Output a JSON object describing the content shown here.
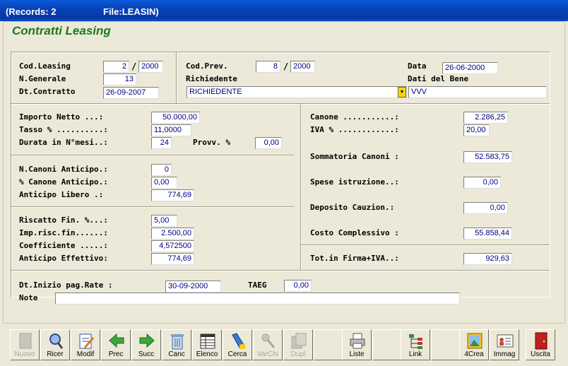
{
  "window": {
    "records": "(Records: 2",
    "file": "File:LEASIN)"
  },
  "form": {
    "title": "Contratti Leasing"
  },
  "header": {
    "cod_leasing_label": "Cod.Leasing",
    "cod_leasing_num": "2",
    "cod_leasing_year": "2000",
    "n_generale_label": "N.Generale",
    "n_generale": "13",
    "dt_contratto_label": "Dt.Contratto",
    "dt_contratto": "26-09-2007",
    "cod_prev_label": "Cod.Prev.",
    "cod_prev_num": "8",
    "cod_prev_year": "2000",
    "richiedente_label": "Richiedente",
    "richiedente": "RICHIEDENTE",
    "data_label": "Data",
    "data": "26-06-2000",
    "dati_bene_label": "Dati del Bene",
    "dati_bene": "VVV",
    "slash": "/"
  },
  "left": {
    "importo_netto_label": "Importo Netto ...:",
    "importo_netto": "50.000,00",
    "tasso_label": "Tasso % ..........:",
    "tasso": "11,0000",
    "durata_label": "Durata in N°mesi..:",
    "durata": "24",
    "provv_label": "Provv. %",
    "provv": "0,00",
    "n_canoni_anticipo_label": "N.Canoni Anticipo.:",
    "n_canoni_anticipo": "0",
    "canone_anticipo_label": "% Canone Anticipo.:",
    "canone_anticipo": "0,00",
    "anticipo_libero_label": "Anticipo Libero .:",
    "anticipo_libero": "774,69",
    "riscatto_label": "Riscatto Fin. %...:",
    "riscatto": "5,00",
    "imp_risc_label": "Imp.risc.fin......:",
    "imp_risc": "2.500,00",
    "coefficiente_label": "Coefficiente .....:",
    "coefficiente": "4,572500",
    "anticipo_effettivo_label": "Anticipo Effettivo:",
    "anticipo_effettivo": "774,69"
  },
  "right": {
    "canone_label": "Canone ...........:",
    "canone": "2.286,25",
    "iva_label": "IVA % ............:",
    "iva": "20,00",
    "sommatoria_label": "Sommatoria Canoni :",
    "sommatoria": "52.583,75",
    "spese_label": "Spese istruzione..:",
    "spese": "0,00",
    "deposito_label": "Deposito Cauzion.:",
    "deposito": "0,00",
    "costo_label": "Costo Complessivo :",
    "costo": "55.858,44",
    "tot_firma_label": "Tot.in Firma+IVA..:",
    "tot_firma": "929,63"
  },
  "footer": {
    "dt_inizio_label": "Dt.Inizio pag.Rate :",
    "dt_inizio": "30-09-2000",
    "taeg_label": "TAEG",
    "taeg": "0,00",
    "note_label": "Note",
    "note": ""
  },
  "toolbar": {
    "nuovo": "Nuovo",
    "ricer": "Ricer",
    "modif": "Modif",
    "prec": "Prec",
    "succ": "Succ",
    "canc": "Canc",
    "elenco": "Elenco",
    "cerca": "Cerca",
    "varchi": "VarChi",
    "dupl": "Dupl",
    "liste": "Liste",
    "link": "Link",
    "crea4": "4Crea",
    "immag": "Immag",
    "uscita": "Uscita"
  },
  "colors": {
    "accent_title": "#1a7a1a",
    "field_text": "#000080",
    "titlebar": "#0842b8"
  }
}
